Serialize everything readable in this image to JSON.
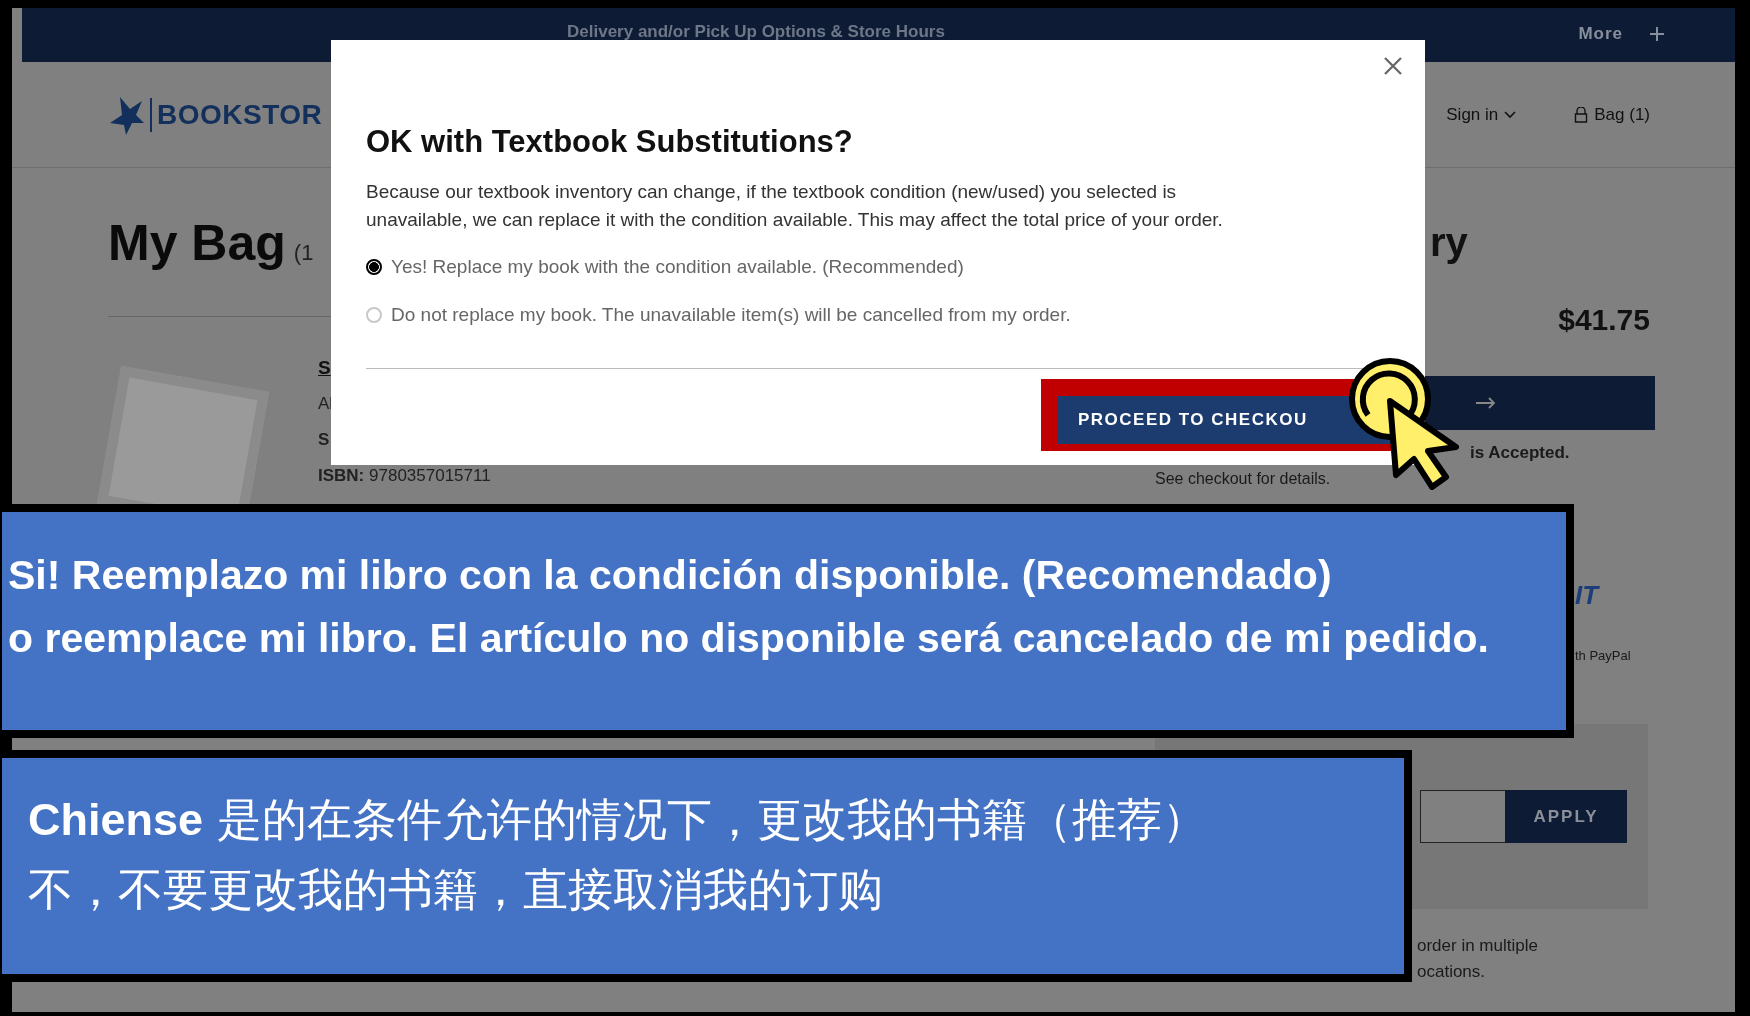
{
  "announcement_bar": {
    "text": "Delivery and/or Pick Up Options & Store Hours",
    "more": "More"
  },
  "header": {
    "logo_text": "BOOKSTOR",
    "sign_in": "Sign in",
    "bag": "Bag (1)"
  },
  "bag": {
    "title": "My Bag",
    "count": "(1",
    "item": {
      "title": "S",
      "line_2": "Al",
      "line_3": "S",
      "isbn_label": "ISBN:",
      "isbn": "9780357015711"
    }
  },
  "summary": {
    "title": "ry",
    "total": "$41.75",
    "accepted_note": "is Accepted.",
    "checkout_note": "See checkout for details.",
    "paypal_logo_text": "IT",
    "paypal_note": "th PayPal",
    "promo_button": "APPLY",
    "pickup_note": [
      "order in multiple",
      "ocations."
    ]
  },
  "modal": {
    "title": "OK with Textbook Substitutions?",
    "body": "Because our textbook inventory can change, if the textbook condition (new/used) you selected is unavailable, we can replace it with the condition available. This may affect the total price of your order.",
    "options": [
      {
        "label": "Yes! Replace my book with the condition available. (Recommended)",
        "selected": true
      },
      {
        "label": "Do not replace my book. The unavailable item(s) will be cancelled from my order.",
        "selected": false
      }
    ],
    "button": "PROCEED TO CHECKOU"
  },
  "annotations": [
    {
      "lines": [
        "Si! Reemplazo mi libro con la condición disponible. (Recomendado)",
        "o reemplace mi libro. El artículo no disponible será cancelado de mi pedido."
      ]
    },
    {
      "lines": [
        "**Chiense** 是的在条件允许的情况下，更改我的书籍（推荐）",
        "不，不要更改我的书籍，直接取消我的订购"
      ]
    }
  ]
}
